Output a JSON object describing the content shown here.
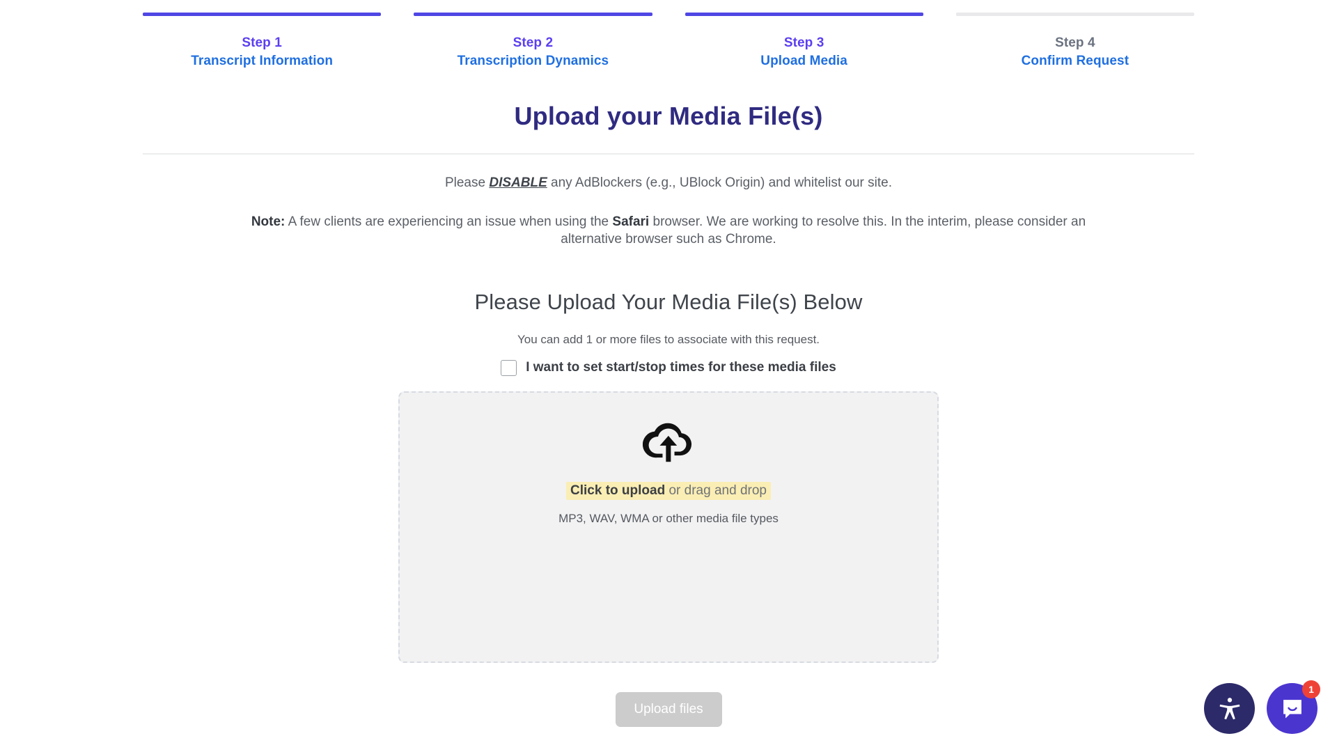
{
  "stepper": {
    "steps": [
      {
        "number": "Step 1",
        "label": "Transcript Information",
        "state": "active"
      },
      {
        "number": "Step 2",
        "label": "Transcription Dynamics",
        "state": "active"
      },
      {
        "number": "Step 3",
        "label": "Upload Media",
        "state": "active"
      },
      {
        "number": "Step 4",
        "label": "Confirm Request",
        "state": "inactive"
      }
    ]
  },
  "header": {
    "title": "Upload your Media File(s)"
  },
  "notices": {
    "adblock": {
      "before": "Please ",
      "emphasis": "DISABLE",
      "after": " any AdBlockers (e.g., UBlock Origin) and whitelist our site."
    },
    "safari": {
      "note_label": "Note:",
      "part1": " A few clients are experiencing an issue when using the ",
      "browser": "Safari",
      "part2": " browser. We are working to resolve this. In the interim, please consider an alternative browser such as Chrome."
    }
  },
  "upload": {
    "heading": "Please Upload Your Media File(s) Below",
    "hint": "You can add 1 or more files to associate with this request.",
    "checkbox_label": "I want to set start/stop times for these media files",
    "checkbox_checked": false,
    "dropzone": {
      "icon": "cloud-upload-icon",
      "cta_strong": "Click to upload",
      "cta_rest": " or drag and drop",
      "file_types": "MP3, WAV, WMA or other media file types"
    },
    "submit_label": "Upload files",
    "submit_disabled": true
  },
  "floating": {
    "accessibility_icon": "accessibility-icon",
    "chat_icon": "chat-bubble-icon",
    "chat_badge": "1"
  },
  "colors": {
    "accent_purple": "#4f46e5",
    "step_number": "#5b3ff0",
    "step_label_blue": "#1f6fe0",
    "title_indigo": "#302b81",
    "highlight_yellow": "#faeeb4",
    "badge_red": "#ef4237",
    "chat_indigo": "#4b35cf",
    "accessibility_navy": "#2c2a69"
  }
}
